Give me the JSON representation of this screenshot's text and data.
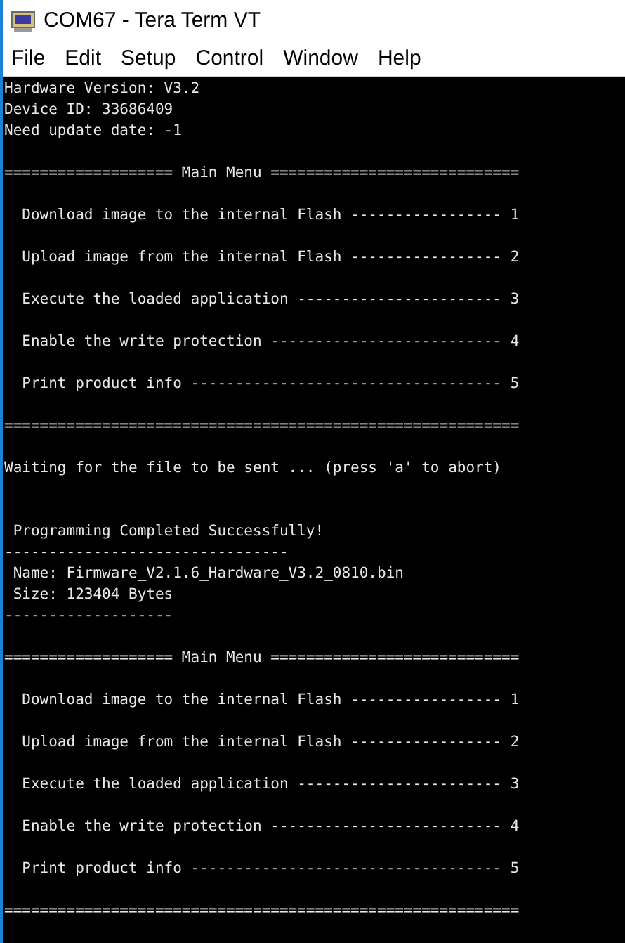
{
  "window": {
    "title": "COM67 - Tera Term VT"
  },
  "menu": [
    "File",
    "Edit",
    "Setup",
    "Control",
    "Window",
    "Help"
  ],
  "terminal": {
    "blocks": [
      {
        "kind": "text",
        "lines": [
          "Hardware Version: V3.2",
          "Device ID: 33686409",
          "Need update date: -1"
        ]
      },
      {
        "kind": "text",
        "lines": [
          "=================== Main Menu ============================"
        ]
      },
      {
        "kind": "menu",
        "lines": [
          "  Download image to the internal Flash ----------------- 1",
          "  Upload image from the internal Flash ----------------- 2",
          "  Execute the loaded application ----------------------- 3",
          "  Enable the write protection -------------------------- 4",
          "  Print product info ----------------------------------- 5"
        ]
      },
      {
        "kind": "text",
        "lines": [
          "=========================================================="
        ]
      },
      {
        "kind": "notice",
        "lines": [
          "Waiting for the file to be sent ... (press 'a' to abort)"
        ]
      },
      {
        "kind": "text",
        "lines": [
          " Programming Completed Successfully!",
          "--------------------------------",
          " Name: Firmware_V2.1.6_Hardware_V3.2_0810.bin",
          " Size: 123404 Bytes",
          "-------------------"
        ]
      },
      {
        "kind": "text",
        "lines": [
          "=================== Main Menu ============================"
        ]
      },
      {
        "kind": "menu",
        "lines": [
          "  Download image to the internal Flash ----------------- 1",
          "  Upload image from the internal Flash ----------------- 2",
          "  Execute the loaded application ----------------------- 3",
          "  Enable the write protection -------------------------- 4",
          "  Print product info ----------------------------------- 5"
        ]
      },
      {
        "kind": "text",
        "lines": [
          "=========================================================="
        ]
      }
    ]
  }
}
